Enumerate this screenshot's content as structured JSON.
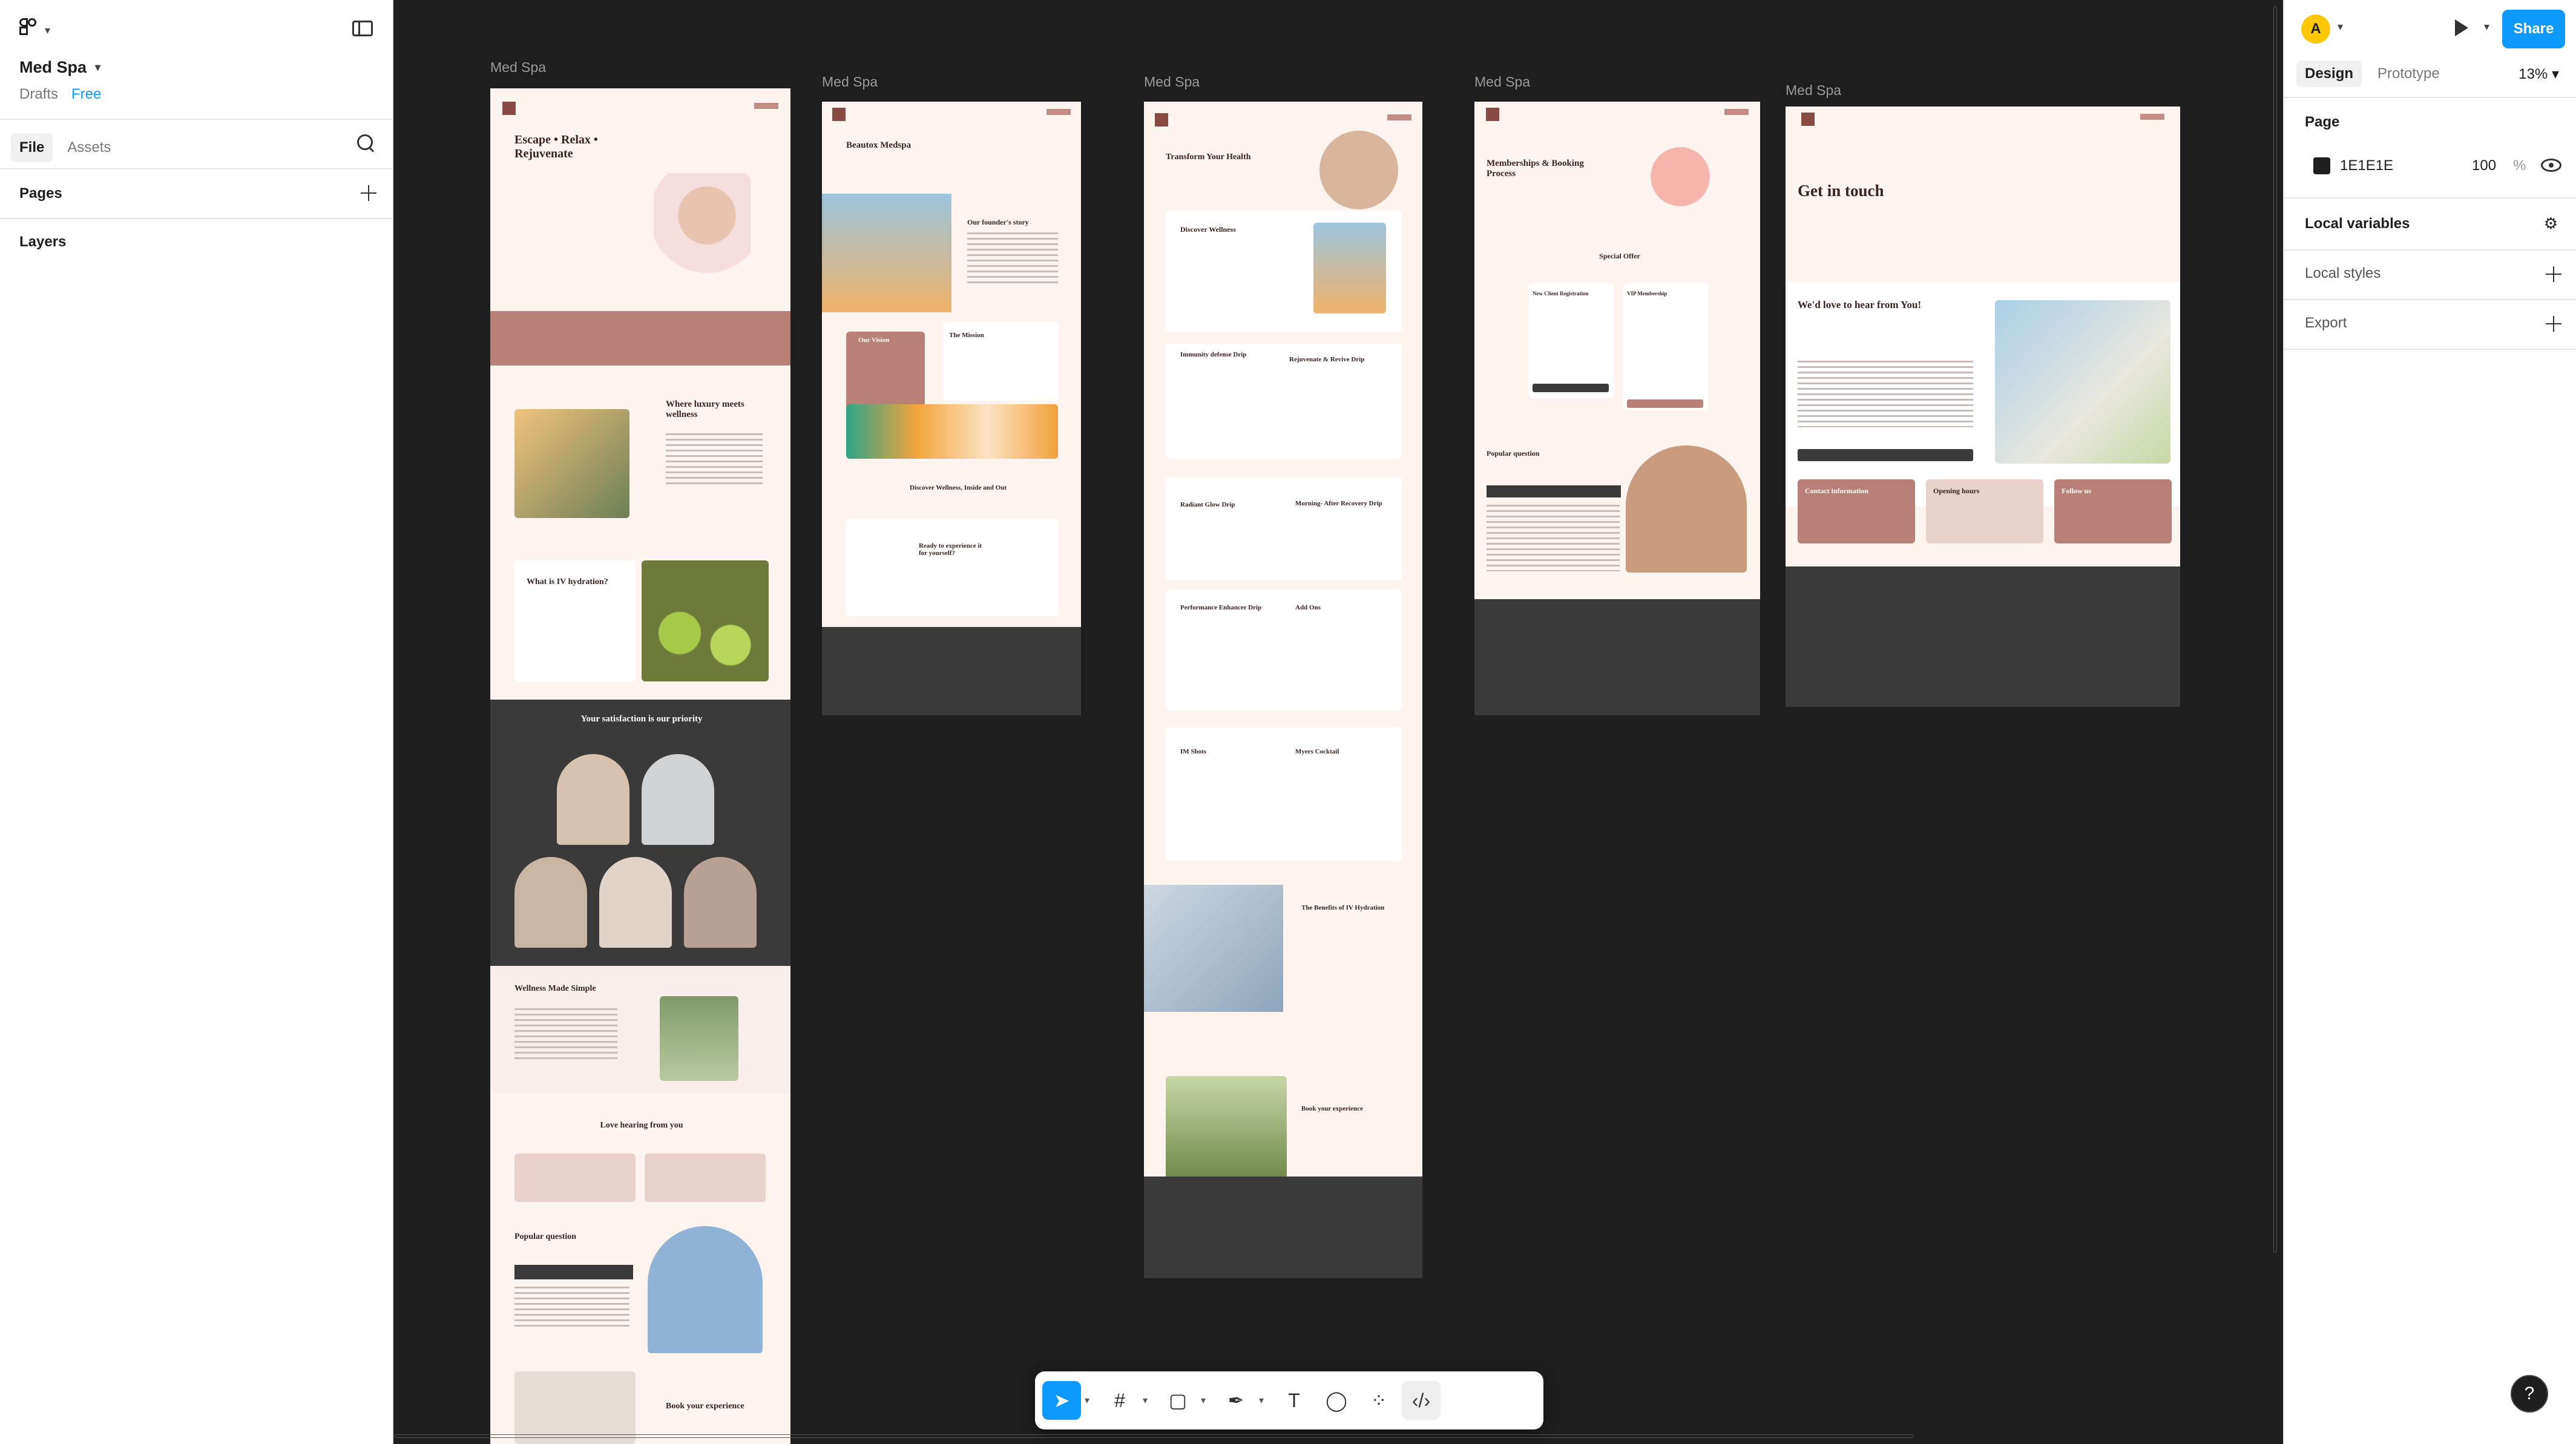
{
  "file": {
    "name": "Med Spa",
    "location": "Drafts",
    "plan": "Free"
  },
  "left_tabs": [
    "File",
    "Assets"
  ],
  "sections": {
    "pages": "Pages",
    "layers": "Layers"
  },
  "frames": [
    {
      "label": "Med Spa",
      "hero": "Escape • Relax • Rejuvenate",
      "h2": "Where luxury meets wellness",
      "h3": "What is IV hydration?",
      "h4": "Your satisfaction is our priority",
      "h5": "Wellness Made Simple",
      "h6": "Love hearing from you",
      "h7": "Popular question",
      "h8": "Book your experience"
    },
    {
      "label": "Med Spa",
      "hero": "Beautox Medspa",
      "h2": "Our founder's story",
      "h3": "Our Vision",
      "h4": "The Mission",
      "h5": "Discover Wellness, Inside and Out",
      "h6": "Ready to experience it for yourself?"
    },
    {
      "label": "Med Spa",
      "hero": "Transform Your Health",
      "h2": "Discover Wellness",
      "h3": "Immunity defense Drip",
      "h3b": "Rejuvenate & Revive Drip",
      "h4": "Radiant Glow Drip",
      "h4b": "Morning- After Recovery Drip",
      "h5": "Performance Enhancer Drip",
      "h5b": "Add Ons",
      "h6": "IM Shots",
      "h6b": "Myers Cocktail",
      "h7": "The Benefits of IV Hydration",
      "h8": "Book your experience"
    },
    {
      "label": "Med Spa",
      "hero": "Memberships & Booking Process",
      "h2": "Special Offer",
      "h3": "New Client Registration",
      "h3b": "VIP Membership",
      "h4": "Popular question"
    },
    {
      "label": "Med Spa",
      "hero": "Get in touch",
      "h2": "We'd love to hear from You!",
      "h3": "Contact information",
      "h4": "Opening hours",
      "h5": "Follow us"
    }
  ],
  "right": {
    "avatar": "A",
    "share": "Share",
    "tabs": [
      "Design",
      "Prototype"
    ],
    "zoom": "13%",
    "page_label": "Page",
    "page_color": "1E1E1E",
    "opacity": "100",
    "opacity_unit": "%",
    "local_variables": "Local variables",
    "local_styles": "Local styles",
    "export": "Export"
  },
  "help": "?"
}
